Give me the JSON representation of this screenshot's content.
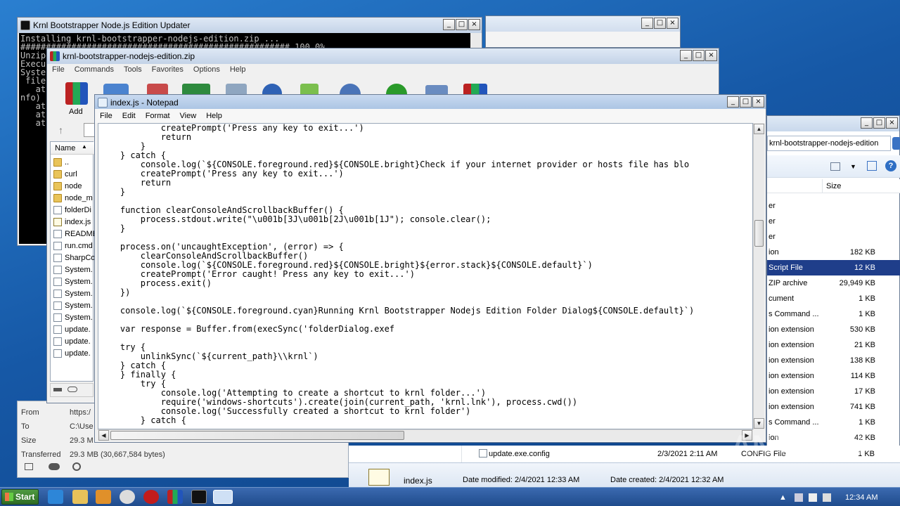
{
  "updater": {
    "title": "Krnl Bootstrapper Node.js Edition Updater",
    "console_lines": [
      "Installing krnl-bootstrapper-nodejs-edition.zip ...",
      "##################################################### 100.0%",
      "Unzip",
      "Execu",
      "Syste",
      " file",
      "   at",
      "nfo)",
      "   at",
      "   at",
      "   at"
    ]
  },
  "winrar": {
    "title": "krnl-bootstrapper-nodejs-edition.zip",
    "menu": [
      "File",
      "Commands",
      "Tools",
      "Favorites",
      "Options",
      "Help"
    ],
    "add_label": "Add",
    "column_name": "Name",
    "files": [
      "..",
      "curl",
      "node",
      "node_m",
      "folderDi",
      "index.js",
      "README",
      "run.cmd",
      "SharpCo",
      "System.",
      "System.",
      "System.",
      "System.",
      "System.",
      "update.",
      "update.",
      "update."
    ]
  },
  "notepad": {
    "title": "index.js - Notepad",
    "menu": [
      "File",
      "Edit",
      "Format",
      "View",
      "Help"
    ],
    "lines": [
      "            createPrompt('Press any key to exit...')",
      "            return",
      "        }",
      "    } catch {",
      "        console.log(`${CONSOLE.foreground.red}${CONSOLE.bright}Check if your internet provider or hosts file has blo",
      "        createPrompt('Press any key to exit...')",
      "        return",
      "    }",
      "",
      "    function clearConsoleAndScrollbackBuffer() {",
      "        process.stdout.write(\"\\u001b[3J\\u001b[2J\\u001b[1J\"); console.clear();",
      "    }",
      "",
      "    process.on('uncaughtException', (error) => {",
      "        clearConsoleAndScrollbackBuffer()",
      "        console.log(`${CONSOLE.foreground.red}${CONSOLE.bright}${error.stack}${CONSOLE.default}`)",
      "        createPrompt('Error caught! Press any key to exit...')",
      "        process.exit()",
      "    })",
      "",
      "    console.log(`${CONSOLE.foreground.cyan}Running Krnl Bootstrapper Nodejs Edition Folder Dialog${CONSOLE.default}`)",
      "",
      "    var response = Buffer.from(execSync('folderDialog.exef",
      "",
      "    try {",
      "        unlinkSync(`${current_path}\\\\krnl`)",
      "    } catch {",
      "    } finally {",
      "        try {",
      "            console.log('Attempting to create a shortcut to krnl folder...')",
      "            require('windows-shortcuts').create(join(current_path, 'krnl.lnk'), process.cwd())",
      "            console.log('Successfully created a shortcut to krnl folder')",
      "        } catch {"
    ]
  },
  "explorer": {
    "address": "krnl-bootstrapper-nodejs-edition",
    "column_size": "Size",
    "rows": [
      {
        "type": "er",
        "size": ""
      },
      {
        "type": "er",
        "size": ""
      },
      {
        "type": "er",
        "size": ""
      },
      {
        "type": "ion",
        "size": "182 KB"
      },
      {
        "type": "Script File",
        "size": "12 KB"
      },
      {
        "type": "ZIP archive",
        "size": "29,949 KB"
      },
      {
        "type": "cument",
        "size": "1 KB"
      },
      {
        "type": "s Command ...",
        "size": "1 KB"
      },
      {
        "type": "ion extension",
        "size": "530 KB"
      },
      {
        "type": "ion extension",
        "size": "21 KB"
      },
      {
        "type": "ion extension",
        "size": "138 KB"
      },
      {
        "type": "ion extension",
        "size": "114 KB"
      },
      {
        "type": "ion extension",
        "size": "17 KB"
      },
      {
        "type": "ion extension",
        "size": "741 KB"
      },
      {
        "type": "s Command ...",
        "size": "1 KB"
      },
      {
        "type": "ion",
        "size": "42 KB"
      }
    ],
    "last_file": {
      "name": "update.exe.config",
      "date": "2/3/2021 2:11 AM",
      "type": "CONFIG File",
      "size": "1 KB"
    },
    "details": {
      "name": "index.js",
      "modified": "Date modified: 2/4/2021 12:33 AM",
      "created": "Date created: 2/4/2021 12:32 AM"
    }
  },
  "download": {
    "from_label": "From",
    "from_value": "https:/",
    "to_label": "To",
    "to_value": "C:\\Use",
    "size_label": "Size",
    "size_value": "29.3 M",
    "transferred_label": "Transferred",
    "transferred_value": "29.3 MB (30,667,584 bytes)"
  },
  "taskbar": {
    "start": "Start",
    "clock": "12:34 AM"
  },
  "watermark": "ANY RUN"
}
